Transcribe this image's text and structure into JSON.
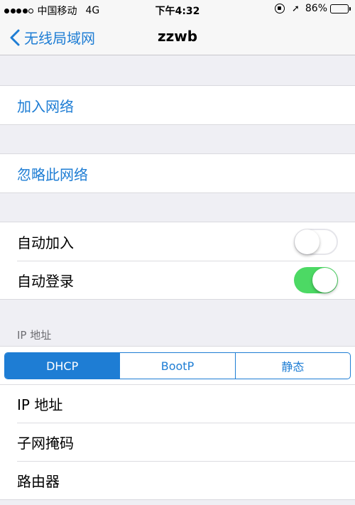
{
  "status": {
    "carrier": "中国移动",
    "network": "4G",
    "time": "下午4:32",
    "battery_percent": "86%",
    "battery_level": 0.86,
    "battery_color": "#f5c400"
  },
  "nav": {
    "back_label": "无线局域网",
    "title": "zzwb"
  },
  "actions": {
    "join": "加入网络",
    "forget": "忽略此网络"
  },
  "settings": {
    "auto_join": {
      "label": "自动加入",
      "enabled": false
    },
    "auto_login": {
      "label": "自动登录",
      "enabled": true
    }
  },
  "ip": {
    "section_header": "IP 地址",
    "segments": [
      "DHCP",
      "BootP",
      "静态"
    ],
    "selected_segment": "DHCP",
    "rows": [
      "IP 地址",
      "子网掩码",
      "路由器"
    ]
  },
  "colors": {
    "accent": "#1e7dd4",
    "toggle_on": "#4cd964",
    "background": "#efeff4"
  }
}
